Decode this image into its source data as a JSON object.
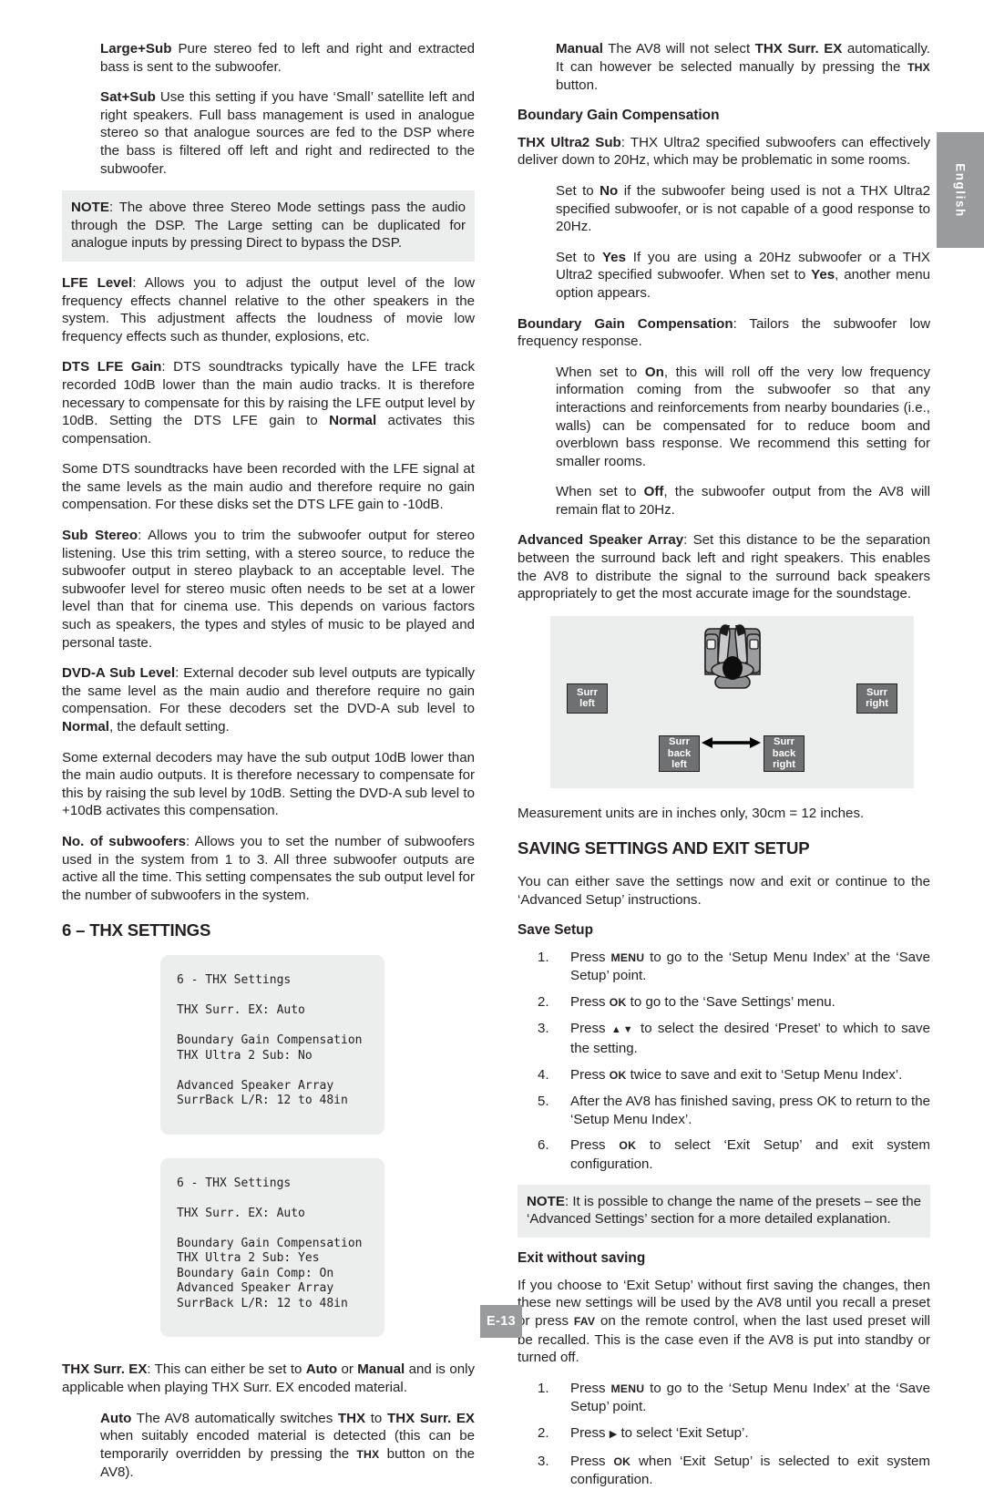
{
  "page": {
    "number_label": "E-13",
    "language_tab": "English"
  },
  "left_column": {
    "para_large_sub": {
      "term": "Large+Sub",
      "body": " Pure stereo fed to left and right and extracted bass is sent to the subwoofer."
    },
    "para_sat_sub": {
      "term": "Sat+Sub",
      "body": " Use this setting if you have ‘Small’ satellite left and right speakers. Full bass management is used in analogue stereo so that analogue sources are fed to the DSP where the bass is filtered off left and right and redirected to the subwoofer."
    },
    "note_stereo_mode": {
      "term": "NOTE",
      "body": ": The above three Stereo Mode settings pass the audio through the DSP. The Large setting can be duplicated for analogue inputs by pressing Direct to bypass the DSP."
    },
    "para_lfe_level": {
      "term": "LFE Level",
      "body": ": Allows you to adjust the output level of the low frequency effects channel relative to the other speakers in the system. This adjustment affects the loudness of movie low frequency effects such as thunder, explosions, etc."
    },
    "para_dts_lfe_gain": {
      "term": "DTS LFE Gain",
      "body_1": ": DTS soundtracks typically have the LFE track recorded 10dB lower than the main audio tracks. It is therefore necessary to compensate for this by raising the LFE output level by 10dB. Setting the DTS LFE gain to ",
      "bold_2": "Normal",
      "body_3": " activates this compensation."
    },
    "para_dts_disks": "Some DTS soundtracks have been recorded with the LFE signal at the same levels as the main audio and therefore require no gain compensation. For these disks set the DTS LFE gain to -10dB.",
    "para_sub_stereo": {
      "term": "Sub Stereo",
      "body": ": Allows you to trim the subwoofer output for stereo listening. Use this trim setting, with a stereo source, to reduce the subwoofer output in stereo playback to an acceptable level. The subwoofer level for stereo music often needs to be set at a lower level than that for cinema use. This depends on various factors such as speakers, the types and styles of music to be played and personal taste."
    },
    "para_dvda_sub_level": {
      "term": "DVD-A Sub Level",
      "body_1": ": External decoder sub level outputs are typically the same level as the main audio and therefore require no gain compensation. For these decoders set the DVD-A sub level to ",
      "bold_2": "Normal",
      "body_3": ", the default setting."
    },
    "para_external_decoders": "Some external decoders may have the sub output 10dB lower than the main audio outputs. It is therefore necessary to compensate for this by raising the sub level by 10dB. Setting the DVD-A sub level to +10dB activates this compensation.",
    "para_no_of_subwoofers": {
      "term": "No. of subwoofers",
      "body": ": Allows you to set the number of subwoofers used in the system from 1 to 3. All three subwoofer outputs are active all the time. This setting compensates the sub output level for the number of subwoofers in the system."
    },
    "heading_thx_settings": "6 – THX SETTINGS",
    "osd_panel_1": [
      "6 - THX Settings",
      "",
      "THX Surr. EX: Auto",
      "",
      "Boundary Gain Compensation",
      "THX Ultra 2 Sub: No",
      "",
      "Advanced Speaker Array",
      "SurrBack L/R: 12 to 48in"
    ],
    "osd_panel_2": [
      "6 - THX Settings",
      "",
      "THX Surr. EX: Auto",
      "",
      "Boundary Gain Compensation",
      "THX Ultra 2 Sub: Yes",
      "Boundary Gain Comp: On",
      "Advanced Speaker Array",
      "SurrBack L/R: 12 to 48in"
    ],
    "para_thx_surr_ex": {
      "term": "THX Surr. EX",
      "body_1": ": This can either be set to ",
      "bold_2": "Auto",
      "body_3": " or ",
      "bold_4": "Manual",
      "body_5": " and is only applicable when playing THX Surr. EX encoded material."
    },
    "para_auto": {
      "term": "Auto",
      "body_1": " The AV8 automatically switches ",
      "bold_2": "THX",
      "body_3": " to ",
      "bold_4": "THX Surr. EX",
      "body_5": " when suitably encoded material is detected (this can be temporarily overridden by pressing the ",
      "smallcaps_6": "THX",
      "body_7": " button on the AV8)."
    }
  },
  "right_column": {
    "para_manual": {
      "term": "Manual",
      "body_1": " The AV8 will not select ",
      "bold_2": "THX Surr. EX",
      "body_3": " automatically. It can however be selected manually by pressing the ",
      "smallcaps_4": "THX",
      "body_5": " button."
    },
    "heading_bgc": "Boundary Gain Compensation",
    "para_thx_ultra2_sub": {
      "term": "THX Ultra2 Sub",
      "body": ": THX Ultra2 specified subwoofers can effectively deliver down to 20Hz, which may be problematic in some rooms."
    },
    "para_set_no": {
      "body_1": "Set to ",
      "bold_2": "No",
      "body_3": " if the subwoofer being used is not a THX Ultra2 specified subwoofer, or is not capable of a good response to 20Hz."
    },
    "para_set_yes": {
      "body_1": "Set to ",
      "bold_2": "Yes",
      "body_3": " If you are using a 20Hz subwoofer or a THX Ultra2 specified subwoofer. When set to ",
      "bold_4": "Yes",
      "body_5": ", another menu option appears."
    },
    "para_bgc_tailors": {
      "term": "Boundary Gain Compensation",
      "body": ": Tailors the subwoofer low frequency response."
    },
    "para_when_on": {
      "body_1": "When set to ",
      "bold_2": "On",
      "body_3": ", this will roll off the very low frequency information coming from the subwoofer so that any interactions and reinforcements from nearby boundaries (i.e., walls) can be compensated for to reduce boom and overblown bass response. We recommend this setting for smaller rooms."
    },
    "para_when_off": {
      "body_1": "When set to ",
      "bold_2": "Off",
      "body_3": ", the subwoofer output from the AV8 will remain flat to 20Hz."
    },
    "para_advanced_speaker_array": {
      "term": "Advanced Speaker Array",
      "body": ": Set this distance to be the separation between the surround back left and right speakers. This enables the AV8 to distribute the signal to the surround back speakers appropriately to get the most accurate image for the soundstage."
    },
    "diagram": {
      "surr_left": [
        "Surr",
        "left"
      ],
      "surr_right": [
        "Surr",
        "right"
      ],
      "surr_back_left": [
        "Surr",
        "back",
        "left"
      ],
      "surr_back_right": [
        "Surr",
        "back",
        "right"
      ]
    },
    "para_measurement_units": "Measurement units are in inches only, 30cm = 12 inches.",
    "heading_saving": "SAVING SETTINGS AND EXIT SETUP",
    "para_save_intro": "You can either save the settings now and exit or continue to the ‘Advanced Setup’ instructions.",
    "heading_save_setup": "Save Setup",
    "save_steps": [
      {
        "num": "1.",
        "body_1": "Press ",
        "smallcaps_2": "MENU",
        "body_3": " to go to the ‘Setup Menu Index’ at the ‘Save Setup’ point."
      },
      {
        "num": "2.",
        "body_1": "Press ",
        "smallcaps_2": "OK",
        "body_3": " to go to the ‘Save Settings’ menu."
      },
      {
        "num": "3.",
        "body_1": "Press ",
        "glyph_2": "▲▼",
        "body_3": " to select the desired ‘Preset’ to which to save the setting."
      },
      {
        "num": "4.",
        "body_1": "Press ",
        "smallcaps_2": "OK",
        "body_3": " twice to save and exit to ‘Setup Menu Index’."
      },
      {
        "num": "5.",
        "body_1": "After the AV8 has finished saving, press OK to return to the ‘Setup Menu Index’.",
        "smallcaps_2": "",
        "body_3": ""
      },
      {
        "num": "6.",
        "body_1": "Press ",
        "smallcaps_2": "OK",
        "body_3": " to select ‘Exit Setup’ and exit system configuration."
      }
    ],
    "note_presets": {
      "term": "NOTE",
      "body": ": It is possible to change the name of the presets – see the ‘Advanced Settings’ section for a more detailed explanation."
    },
    "heading_exit_without_saving": "Exit without saving",
    "para_exit_intro": {
      "body_1": "If you choose to ‘Exit Setup’ without first saving the changes, then these new settings will be used by the AV8 until you recall a preset or press ",
      "smallcaps_2": "FAV",
      "body_3": " on the remote control, when the last used preset will be recalled. This is the case even if the AV8 is put into standby or turned off."
    },
    "exit_steps": [
      {
        "num": "1.",
        "body_1": "Press ",
        "smallcaps_2": "MENU",
        "body_3": " to go to the ‘Setup Menu Index’ at the ‘Save Setup’ point."
      },
      {
        "num": "2.",
        "body_1": "Press ",
        "glyph_2": "▶",
        "body_3": " to select ‘Exit Setup’."
      },
      {
        "num": "3.",
        "body_1": "Press ",
        "smallcaps_2": "OK",
        "body_3": " when ‘Exit Setup’ is selected to exit system configuration."
      }
    ]
  },
  "colors": {
    "note_background": "#eceded",
    "panel_background": "#eceded",
    "speaker_fill": "#6f7072",
    "tab_background": "#9a9b9d",
    "text": "#231f20"
  }
}
